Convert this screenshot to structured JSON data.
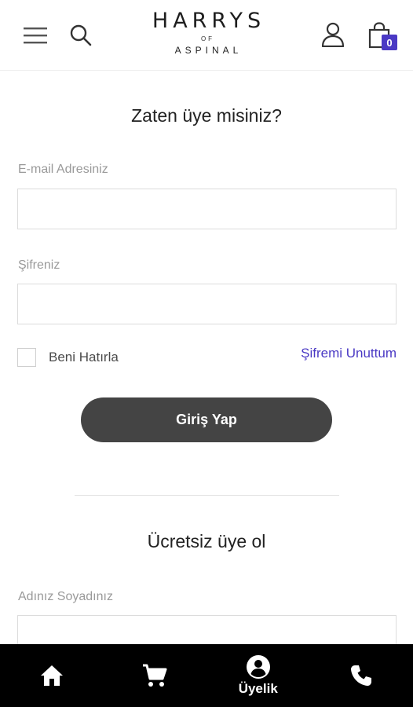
{
  "header": {
    "logo": {
      "main": "HARRYS",
      "of": "OF",
      "sub": "ASPINAL"
    },
    "icons": {
      "menu": "hamburger-menu-icon",
      "search": "search-icon",
      "account": "user-icon",
      "cart": "shopping-bag-icon"
    },
    "cart_count": "0"
  },
  "login": {
    "title": "Zaten üye misiniz?",
    "email_label": "E-mail Adresiniz",
    "email_value": "",
    "password_label": "Şifreniz",
    "password_value": "",
    "remember_label": "Beni Hatırla",
    "remember_checked": false,
    "forgot_label": "Şifremi Unuttum",
    "submit_label": "Giriş Yap"
  },
  "register": {
    "title": "Ücretsiz üye ol",
    "name_label": "Adınız Soyadınız",
    "name_value": ""
  },
  "bottom_nav": {
    "items": [
      {
        "icon": "home-icon",
        "label": ""
      },
      {
        "icon": "cart-icon",
        "label": ""
      },
      {
        "icon": "account-circle-icon",
        "label": "Üyelik"
      },
      {
        "icon": "phone-icon",
        "label": ""
      }
    ]
  },
  "colors": {
    "accent": "#4a39c4",
    "button": "#444444",
    "nav_background": "#000000",
    "label": "#9a9a9a"
  }
}
